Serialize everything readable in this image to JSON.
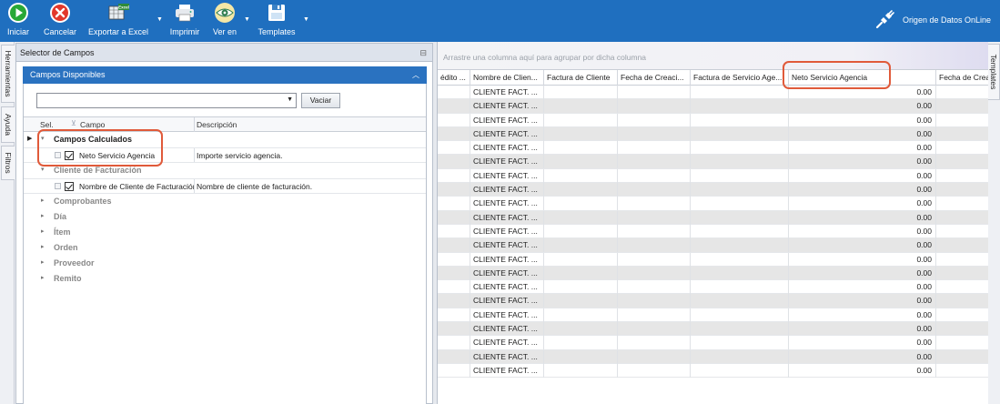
{
  "toolbar": {
    "buttons": [
      {
        "label": "Iniciar",
        "icon": "play-icon"
      },
      {
        "label": "Cancelar",
        "icon": "cancel-icon"
      },
      {
        "label": "Exportar a Excel",
        "icon": "excel-icon",
        "icon_text": "Excel"
      },
      {
        "label": "Imprimir",
        "icon": "printer-icon"
      },
      {
        "label": "Ver en",
        "icon": "eye-icon"
      },
      {
        "label": "Templates",
        "icon": "floppy-icon"
      }
    ],
    "connection_label": "Origen de Datos OnLine"
  },
  "side_tabs": [
    "Herramientas",
    "Ayuda",
    "Filtros"
  ],
  "selector": {
    "title": "Selector de Campos",
    "panel_title": "Campos Disponibles",
    "combo_value": "",
    "clear_button": "Vaciar",
    "columns": {
      "sel": "Sel.",
      "field": "Campo",
      "description": "Descripción"
    },
    "groups": [
      {
        "name": "Campos Calculados",
        "fields": [
          {
            "name": "Neto Servicio Agencia",
            "description": "Importe servicio agencia."
          }
        ]
      },
      {
        "name": "Cliente de Facturación",
        "fields": [
          {
            "name": "Nombre de Cliente de Facturación",
            "description": "Nombre de cliente de facturación."
          }
        ]
      },
      {
        "name": "Comprobantes"
      },
      {
        "name": "Día"
      },
      {
        "name": "Ítem"
      },
      {
        "name": "Orden"
      },
      {
        "name": "Proveedor"
      },
      {
        "name": "Remito"
      }
    ]
  },
  "grid": {
    "group_hint": "Arrastre una columna aquí para agrupar por dicha columna",
    "columns": [
      "édito ...",
      "Nombre de Clien...",
      "Factura de Cliente",
      "Fecha de Creaci...",
      "Factura de Servicio Age...",
      "Neto Servicio Agencia",
      "Fecha de Crea"
    ],
    "row_client": "CLIENTE FACT. ...",
    "row_value": "0.00",
    "row_count": 21
  },
  "right_tab": "Templates",
  "colors": {
    "toolbar": "#1f6fbf",
    "panel_header": "#2a72c0",
    "highlight": "#e05a3a"
  }
}
